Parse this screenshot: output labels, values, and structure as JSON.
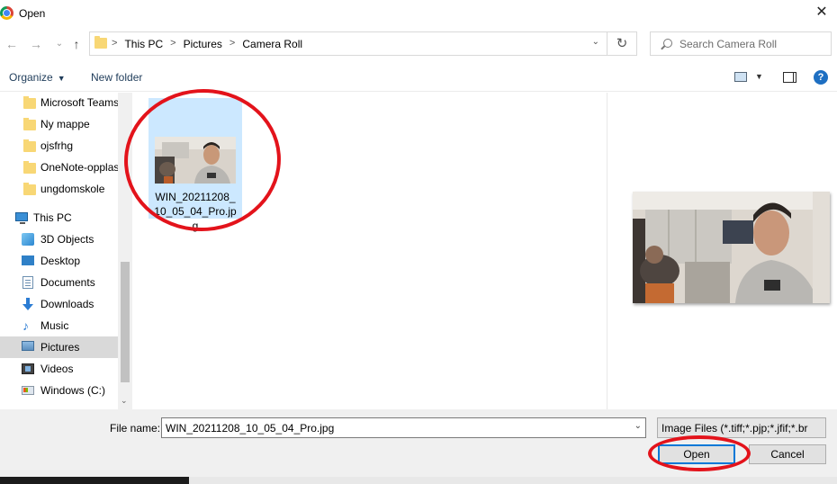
{
  "window": {
    "title": "Open",
    "close_glyph": "✕"
  },
  "address": {
    "crumbs": [
      "This PC",
      "Pictures",
      "Camera Roll"
    ],
    "separator": ">",
    "dropdown_glyph": "⌄",
    "refresh_glyph": "↻"
  },
  "search": {
    "placeholder": "Search Camera Roll"
  },
  "nav_buttons": {
    "back": "←",
    "forward": "→",
    "recent": "⌄",
    "up": "↑"
  },
  "commands": {
    "organize": "Organize",
    "organize_caret": "▼",
    "new_folder": "New folder",
    "help": "?",
    "view_caret": "▼"
  },
  "sidebar": {
    "items": [
      {
        "label": "Microsoft Teams",
        "icon": "folder-icon"
      },
      {
        "label": "Ny mappe",
        "icon": "folder-icon"
      },
      {
        "label": "ojsfrhg",
        "icon": "folder-icon"
      },
      {
        "label": "OneNote-opplas",
        "icon": "folder-icon"
      },
      {
        "label": "ungdomskole",
        "icon": "folder-icon"
      },
      {
        "label": "This PC",
        "icon": "pc-icon"
      },
      {
        "label": "3D Objects",
        "icon": "3d-objects-icon"
      },
      {
        "label": "Desktop",
        "icon": "desktop-icon"
      },
      {
        "label": "Documents",
        "icon": "documents-icon"
      },
      {
        "label": "Downloads",
        "icon": "downloads-icon"
      },
      {
        "label": "Music",
        "icon": "music-icon"
      },
      {
        "label": "Pictures",
        "icon": "pictures-icon",
        "selected": true
      },
      {
        "label": "Videos",
        "icon": "videos-icon"
      },
      {
        "label": "Windows (C:)",
        "icon": "drive-icon"
      }
    ],
    "scroll_down_glyph": "⌄"
  },
  "files": [
    {
      "name": "WIN_20211208_10_05_04_Pro.jpg",
      "selected": true
    }
  ],
  "footer": {
    "file_name_label": "File name:",
    "file_name_value": "WIN_20211208_10_05_04_Pro.jpg",
    "dropdown_glyph": "⌄",
    "file_type": "Image Files (*.tiff;*.pjp;*.jfif;*.br",
    "open_label": "Open",
    "cancel_label": "Cancel"
  },
  "colors": {
    "selection": "#cce8ff",
    "annotation": "#e3131b",
    "accent": "#0078d7",
    "folder": "#f8d775"
  }
}
